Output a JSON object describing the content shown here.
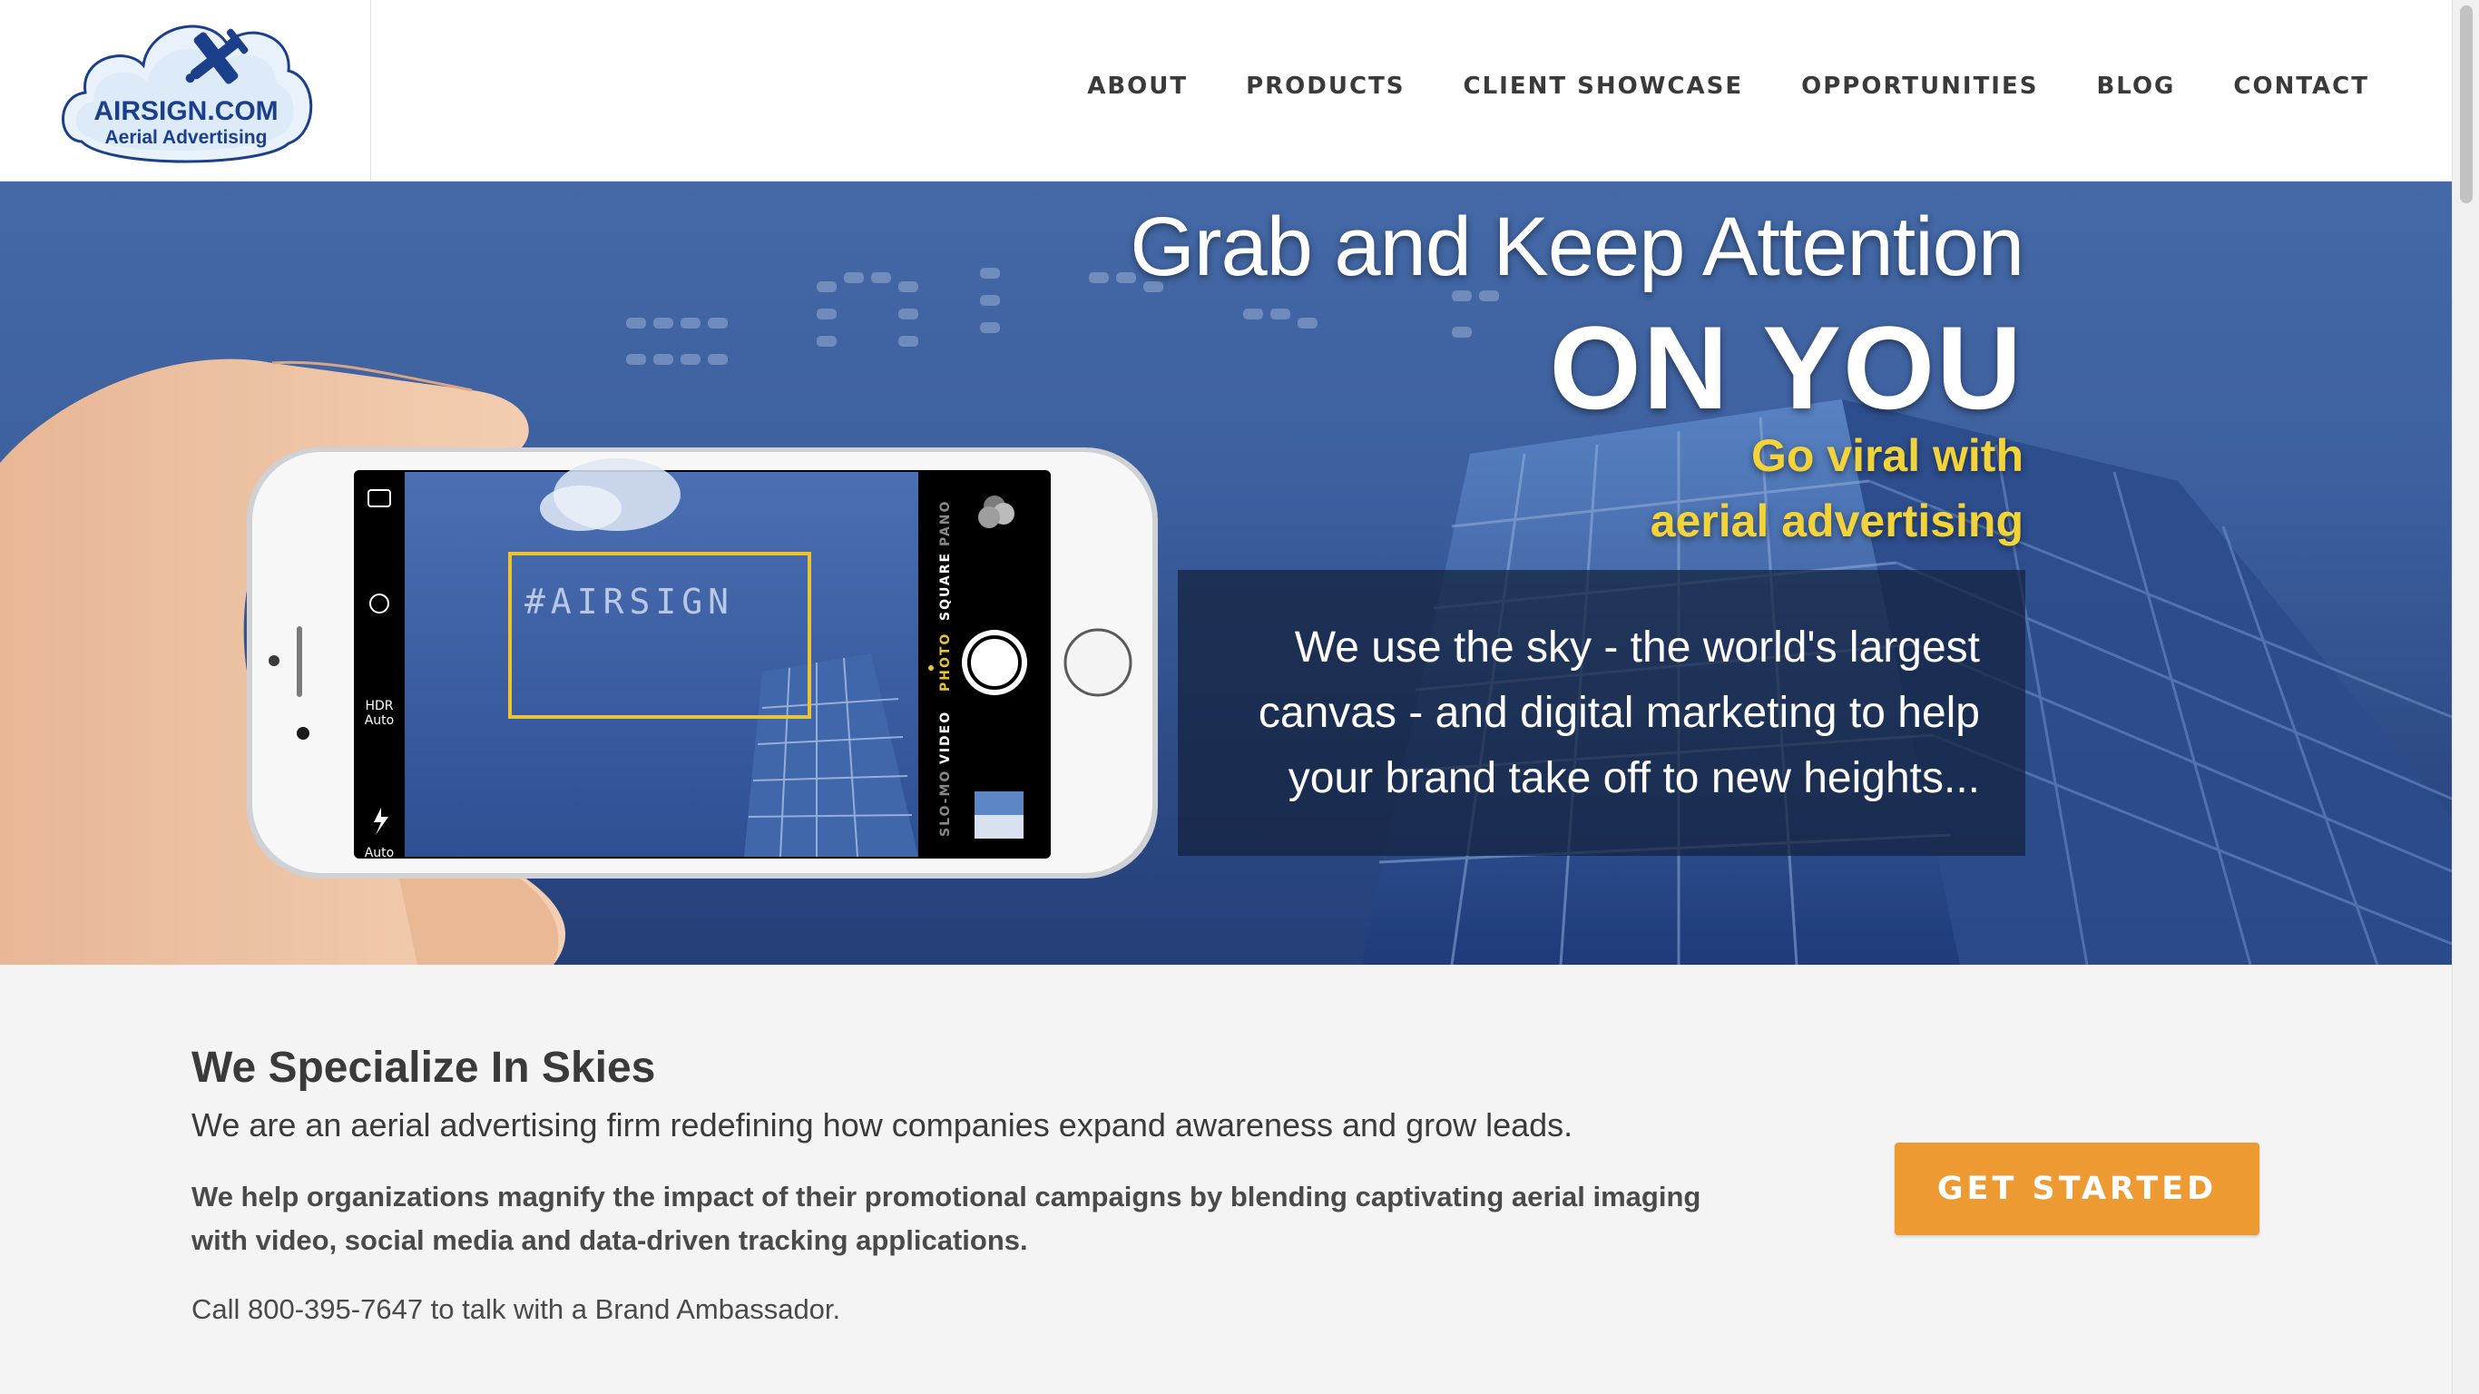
{
  "logo": {
    "brand": "AIRSIGN.COM",
    "tagline": "Aerial Advertising",
    "icon": "airplane-icon"
  },
  "nav": {
    "items": [
      "ABOUT",
      "PRODUCTS",
      "CLIENT SHOWCASE",
      "OPPORTUNITIES",
      "BLOG",
      "CONTACT"
    ]
  },
  "hero": {
    "headline_1": "Grab and Keep Attention",
    "headline_2": "ON YOU",
    "tagline_1": "Go viral with",
    "tagline_2": "aerial advertising",
    "panel_text": "We use the sky - the world's largest canvas - and digital marketing to help your brand take off to new heights...",
    "sky_text": "#AIRSIGN",
    "phone": {
      "modes": [
        "SLO-MO",
        "VIDEO",
        "PHOTO",
        "SQUARE",
        "PANO"
      ],
      "active_mode": "PHOTO",
      "hdr_label": "HDR",
      "hdr_value": "Auto",
      "flash_value": "Auto"
    }
  },
  "content": {
    "title": "We Specialize In Skies",
    "subtitle": "We are an aerial advertising firm redefining how companies expand awareness and grow leads.",
    "body": "We help organizations magnify the impact of their promotional campaigns by blending captivating aerial imaging with video, social media and data-driven tracking applications.",
    "call": "Call 800-395-7647 to talk with a Brand Ambassador.",
    "cta": "GET STARTED"
  },
  "colors": {
    "brand_blue": "#1c3f8c",
    "accent_yellow": "#f2d43a",
    "cta_orange": "#ee9a32",
    "hero_blue": "#3d5f9e"
  }
}
